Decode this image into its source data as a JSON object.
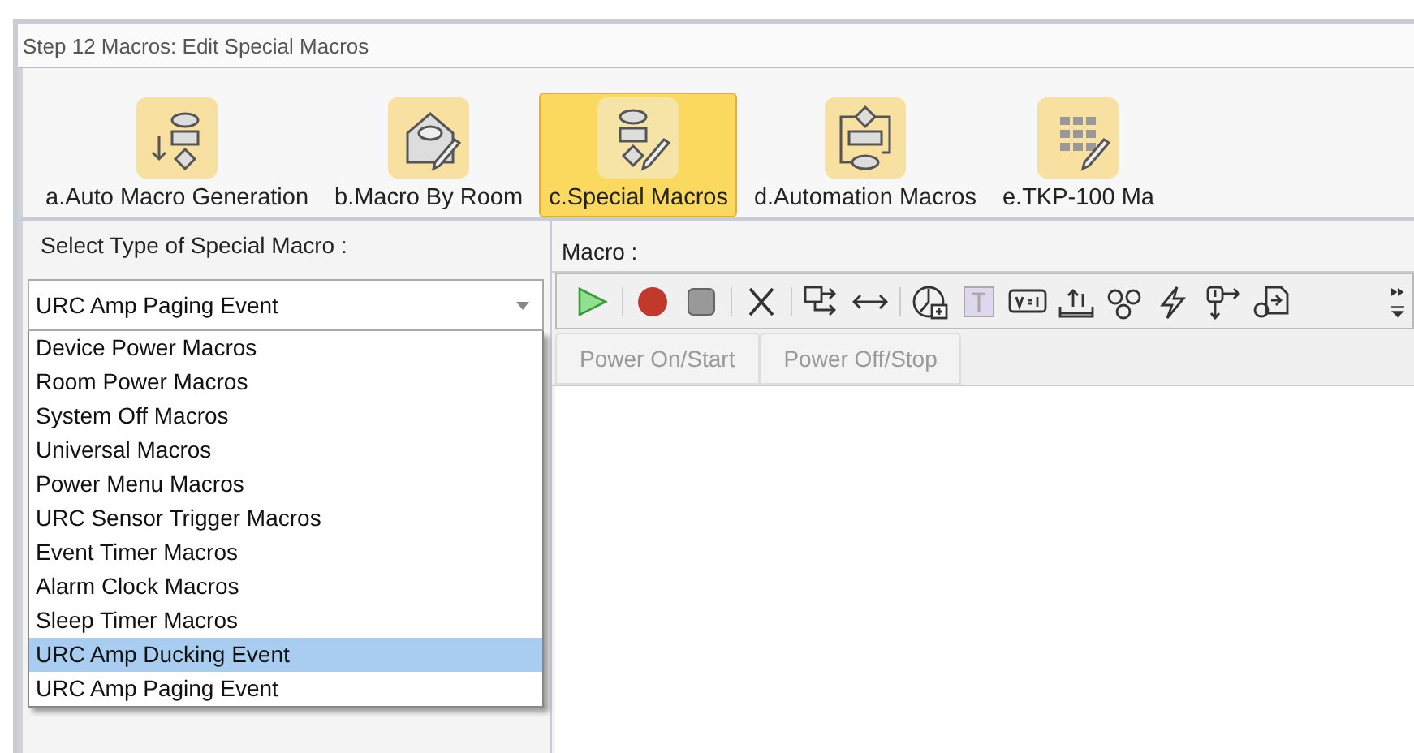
{
  "window": {
    "title": "Step 12 Macros: Edit Special Macros"
  },
  "ribbon": [
    {
      "label": "a.Auto Macro Generation",
      "selected": false
    },
    {
      "label": "b.Macro By Room",
      "selected": false
    },
    {
      "label": "c.Special Macros",
      "selected": true
    },
    {
      "label": "d.Automation Macros",
      "selected": false
    },
    {
      "label": "e.TKP-100 Ma",
      "selected": false
    }
  ],
  "left": {
    "heading": "Select Type of Special Macro :",
    "combo": {
      "value": "URC Amp Paging Event",
      "expanded": true
    },
    "options": [
      {
        "label": "Device Power Macros",
        "selected": false
      },
      {
        "label": "Room Power Macros",
        "selected": false
      },
      {
        "label": "System Off Macros",
        "selected": false
      },
      {
        "label": "Universal Macros",
        "selected": false
      },
      {
        "label": "Power Menu Macros",
        "selected": false
      },
      {
        "label": "URC Sensor Trigger Macros",
        "selected": false
      },
      {
        "label": "Event Timer Macros",
        "selected": false
      },
      {
        "label": "Alarm Clock Macros",
        "selected": false
      },
      {
        "label": "Sleep Timer Macros",
        "selected": false
      },
      {
        "label": "URC Amp Ducking Event",
        "selected": true
      },
      {
        "label": "URC Amp Paging Event",
        "selected": false
      }
    ]
  },
  "right": {
    "heading": "Macro :",
    "tabs": [
      {
        "label": "Power On/Start",
        "disabled": true
      },
      {
        "label": "Power Off/Stop",
        "disabled": true
      }
    ]
  }
}
